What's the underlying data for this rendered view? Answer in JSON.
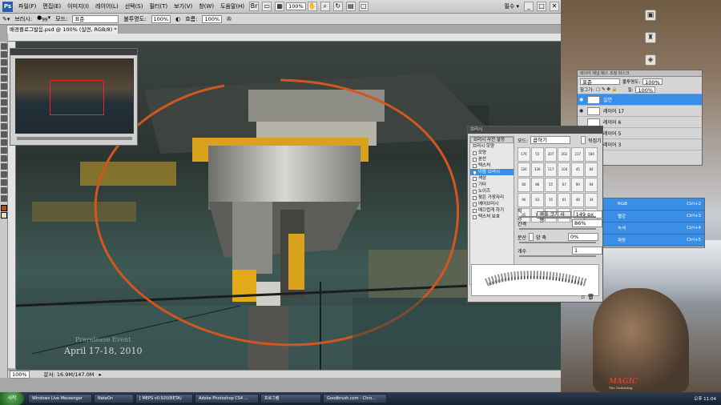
{
  "menubar": {
    "items": [
      "파일(F)",
      "편집(E)",
      "이미지(I)",
      "레이어(L)",
      "선택(S)",
      "필터(T)",
      "보기(V)",
      "창(W)",
      "도움말(H)"
    ],
    "zoom": "100%",
    "workspace": "필수 ▾"
  },
  "options": {
    "brush_label": "브러시:",
    "brush_size": "99",
    "mode_label": "모드:",
    "mode_value": "표준",
    "opacity_label": "불투명도:",
    "opacity_value": "100%",
    "flow_label": "흐름:",
    "flow_value": "100%"
  },
  "document": {
    "tab_title": "배경플로그발음.psd @ 100% (실연, RGB/8) *",
    "status_zoom": "100%",
    "status_doc": "문서: 16.9M/147.0M"
  },
  "canvas_text": {
    "date": "April 17-18, 2010",
    "event": "Prerelease Event"
  },
  "desktop": {
    "logo_text": "MAGIC",
    "logo_sub": "The Gathering"
  },
  "layers": {
    "tabs": "레이어  채널  패스  조정  마스크",
    "blend_mode": "표준",
    "opacity_label": "불투명도:",
    "opacity_value": "100%",
    "lock_label": "잠그기:",
    "fill_label": "칠:",
    "fill_value": "100%",
    "rows": [
      {
        "name": "실연",
        "selected": true
      },
      {
        "name": "레이어 17",
        "selected": false
      },
      {
        "name": "레이어 6",
        "selected": false
      },
      {
        "name": "레이어 5",
        "selected": false
      },
      {
        "name": "레이어 3",
        "selected": false
      }
    ]
  },
  "channels": {
    "rows": [
      {
        "name": "RGB",
        "shortcut": "Ctrl+2"
      },
      {
        "name": "빨강",
        "shortcut": "Ctrl+3"
      },
      {
        "name": "녹색",
        "shortcut": "Ctrl+4"
      },
      {
        "name": "파랑",
        "shortcut": "Ctrl+5"
      }
    ]
  },
  "brushes": {
    "title": "브러시",
    "tab_label": "브러시 사전 설정",
    "mode_label": "모드:",
    "mode_value": "곱하기",
    "reverse_label": "뒤집기",
    "left_items": [
      {
        "label": "브러시 모양",
        "head": true,
        "checked": false
      },
      {
        "label": "모양",
        "head": false,
        "checked": false
      },
      {
        "label": "분산",
        "head": false,
        "checked": false
      },
      {
        "label": "텍스처",
        "head": false,
        "checked": false
      },
      {
        "label": "이중 브러시",
        "head": false,
        "checked": true,
        "highlight": true
      },
      {
        "label": "색상",
        "head": false,
        "checked": false
      },
      {
        "label": "기타",
        "head": false,
        "checked": false
      },
      {
        "label": "노이즈",
        "head": false,
        "checked": false
      },
      {
        "label": "젖은 가장자리",
        "head": false,
        "checked": false
      },
      {
        "label": "에어브러시",
        "head": false,
        "checked": false
      },
      {
        "label": "매끄럽게 하기",
        "head": false,
        "checked": false
      },
      {
        "label": "텍스처 보호",
        "head": false,
        "checked": false
      }
    ],
    "tips": [
      "176",
      "55",
      "207",
      "202",
      "237",
      "180",
      "326",
      "336",
      "117",
      "104",
      "45",
      "84",
      "60",
      "86",
      "55",
      "67",
      "90",
      "94",
      "96",
      "83",
      "35",
      "61",
      "48",
      "34",
      "45",
      "72",
      "59",
      "40",
      "88",
      "126"
    ],
    "diameter_label": "직경",
    "use_sample": "샘플 크기 사용",
    "diameter_value": "149 px",
    "spacing_label": "간격",
    "spacing_value": "86%",
    "scatter_label": "분산",
    "both_axes": "양 축",
    "scatter_value": "0%",
    "count_label": "개수",
    "count_value": "1"
  },
  "taskbar": {
    "start": "시작",
    "tasks": [
      "Windows Live Messenger",
      "NateOn",
      "[ MEPS v0.920(BETA)",
      "Adobe Photoshop CS4 ...",
      "프로그램",
      "Goodbrush.com - Chro..."
    ],
    "clock": "오후 11:04"
  },
  "colors": {
    "accent": "#3a8ee6",
    "stroke": "#d2561f"
  }
}
